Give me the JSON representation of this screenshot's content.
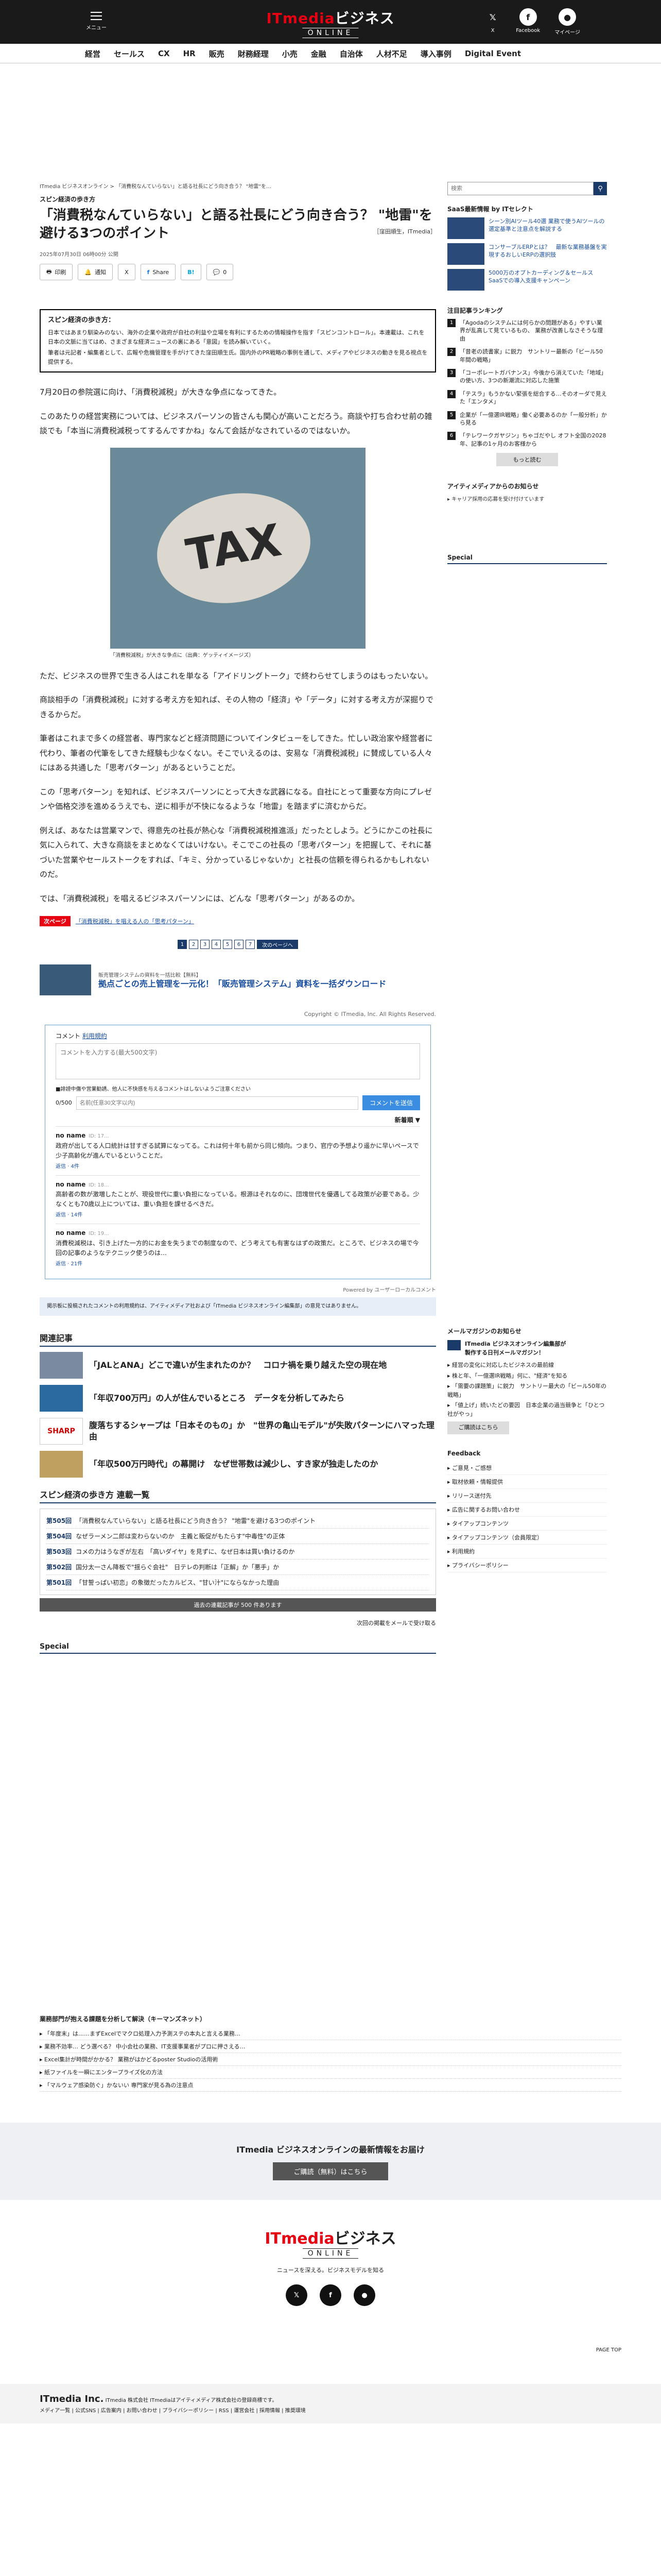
{
  "header": {
    "menu_label": "メニュー",
    "logo_main": "ITmedia",
    "logo_main2": "ビジネス",
    "logo_sub": "ONLINE",
    "x_label": "X",
    "facebook_label": "Facebook",
    "mypage_label": "マイページ"
  },
  "nav": [
    "経営",
    "セールス",
    "CX",
    "HR",
    "販売",
    "財務経理",
    "小売",
    "金融",
    "自治体",
    "人材不足",
    "導入事例",
    "Digital Event"
  ],
  "breadcrumb": "ITmedia ビジネスオンライン > 「消費税なんていらない」と語る社長にどう向き合う？ \"地雷\"を…",
  "article": {
    "series": "スピン経済の歩き方",
    "title": "「消費税なんていらない」と語る社長にどう向き合う？ \"地雷\"を避ける3つのポイント",
    "byline": "［窪田順生，ITmedia］",
    "date": "2025年07月30日 06時00分 公開",
    "share": [
      "印刷",
      "通知",
      "X",
      "Share",
      "B!",
      "0"
    ],
    "series_box_head": "スピン経済の歩き方：",
    "series_box_body": "日本ではあまり馴染みのない、海外の企業や政府が自社の利益や立場を有利にするための情報操作を指す「スピンコントロール」。本連載は、これを日本の文脈に当てはめ、さまざまな経済ニュースの裏にある「意図」を読み解いていく。",
    "series_box_body2": "筆者は元記者・編集者として、広報や危機管理を手がけてきた窪田順生氏。国内外のPR戦略の事例を通して、メディアやビジネスの動きを見る視点を提供する。",
    "p1": "7月20日の参院選に向け、「消費税減税」が大きな争点になってきた。",
    "p2": "このあたりの経営実務については、ビジネスパーソンの皆さんも関心が高いことだろう。商談や打ち合わせ前の雑談でも「本当に消費税減税ってするんですかね」なんて会話がなされているのではないか。",
    "photo_text": "TAX",
    "caption": "「消費税減税」が大きな争点に（出典：ゲッティイメージズ）",
    "p3": "ただ、ビジネスの世界で生きる人はこれを単なる「アイドリングトーク」で終わらせてしまうのはもったいない。",
    "p4": "商談相手の「消費税減税」に対する考え方を知れば、その人物の「経済」や「データ」に対する考え方が深掘りできるからだ。",
    "p5": "筆者はこれまで多くの経営者、専門家などと経済問題についてインタビューをしてきた。忙しい政治家や経営者に代わり、筆者の代筆をしてきた経験も少なくない。そこでいえるのは、安易な「消費税減税」に賛成している人々にはある共通した「思考パターン」があるということだ。",
    "p6": "この「思考パターン」を知れば、ビジネスパーソンにとって大きな武器になる。自社にとって重要な方向にプレゼンや価格交渉を進めるうえでも、逆に相手が不快になるような「地雷」を踏まずに済むからだ。",
    "p7": "例えば、あなたは営業マンで、得意先の社長が熱心な「消費税減税推進派」だったとしよう。どうにかこの社長に気に入られて、大きな商談をまとめなくてはいけない。そこでこの社長の「思考パターン」を把握して、それに基づいた営業やセールストークをすれば、「キミ、分かっているじゃないか」と社長の信頼を得られるかもしれないのだ。",
    "p8": "では、「消費税減税」を唱えるビジネスパーソンには、どんな「思考パターン」があるのか。",
    "next_tag": "次ページ",
    "next_link": "「消費税減税」を唱える人の「思考パターン」",
    "pages": [
      "1",
      "2",
      "3",
      "4",
      "5",
      "6",
      "7"
    ],
    "next_btn": "次のページへ",
    "promo_sub": "販売管理システムの資料を一括比較【無料】",
    "promo_title": "拠点ごとの売上管理を一元化！「販売管理システム」資料を一括ダウンロード",
    "copyright": "Copyright © ITmedia, Inc. All Rights Reserved."
  },
  "comments": {
    "label": "コメント",
    "label_link": "利用規約",
    "placeholder": "コメントを入力する(最大500文字)",
    "note": "■誹謗中傷や営業勧誘、他人に不快感を与えるコメントはしないようご注意ください",
    "counter": "0/500",
    "nick_placeholder": "名前(任意30文字以内)",
    "submit": "コメントを送信",
    "sort": "新着順 ▼",
    "items": [
      {
        "name": "no name",
        "date": "ID: 17...",
        "text": "政府が出してる人口統計は甘すぎる試算になってる。これは何十年も前から同じ傾向。つまり、官庁の予想より遥かに早いペースで少子高齢化が進んでいるということだ。",
        "meta": "返信 · 4件"
      },
      {
        "name": "no name",
        "date": "ID: 18...",
        "text": "高齢者の数が激増したことが、現役世代に重い負担になっている。根源はそれなのに、団塊世代を優遇してる政策が必要である。少なくとも70歳以上については、重い負担を課せるべきだ。",
        "meta": "返信 · 14件"
      },
      {
        "name": "no name",
        "date": "ID: 19...",
        "text": "消費税減税は、引き上げた一方的にお金を失うまでの制度なので、どう考えても有害なはずの政策だ。ところで、ビジネスの場で今回の記事のようなテクニック使うのは…",
        "meta": "返信 · 21件"
      }
    ],
    "powered": "Powered by ユーザーローカルコメント",
    "policy": "掲示板に投稿されたコメントの利用規約は、アイティメディア社および「ITmedia ビジネスオンライン編集部」の意見ではありません。"
  },
  "related": {
    "heading": "関連記事",
    "items": [
      {
        "title": "「JALとANA」どこで違いが生まれたのか？　コロナ禍を乗り越えた空の現在地",
        "img": ""
      },
      {
        "title": "「年収700万円」の人が住んでいるところ　データを分析してみたら",
        "img": ""
      },
      {
        "title": "腹落ちするシャープは「日本そのもの」か　\"世界の亀山モデル\"が失敗パターンにハマった理由",
        "img": "SHARP"
      },
      {
        "title": "「年収500万円時代」の幕開け　なぜ世帯数は減少し、すき家が独走したのか",
        "img": ""
      }
    ]
  },
  "series_list": {
    "heading": "スピン経済の歩き方 連載一覧",
    "items": [
      {
        "no": "第505回",
        "title": "「消費税なんていらない」と語る社長にどう向き合う？ \"地雷\"を避ける3つのポイント"
      },
      {
        "no": "第504回",
        "title": "なぜラーメン二郎は変わらないのか　主義と販促がもたらす\"中毒性\"の正体"
      },
      {
        "no": "第503回",
        "title": "コメの力はうなぎが左右　「高いダイヤ」を見ずに、なぜ日本は買い負けるのか"
      },
      {
        "no": "第502回",
        "title": "国分太一さん降板で\"揺らぐ会社\"　日テレの判断は「正解」か「悪手」か"
      },
      {
        "no": "第501回",
        "title": "「甘誓っぱい初恋」の象徴だったカルビス、\"甘い汁\"にならなかった理由"
      }
    ],
    "past": "過去の連載記事が 500 件あります",
    "mail": "次回の掲載をメールで受け取る"
  },
  "special_heading": "Special",
  "sidebar": {
    "search_placeholder": "検索",
    "saas_heading": "SaaS最新情報 by ITセレクト",
    "saas_items": [
      "シーン別AIツール40選 業務で使うAIツールの選定基準と注意点を解説する",
      "コンサーブルERPとは？　最新な業務基盤を実現するおしいERPの選択肢",
      "5000万のオプトカーディング＆セールスSaaSでの導入支援キャンペーン"
    ],
    "rank_heading": "注目記事ランキング",
    "rank": [
      "「Agodaのシステムには何らかの問題がある」やすい業界が乱高して見ているもの、 業務が改善しなさそうな理由",
      "「昔老の読書家」に鋭力　サントリー最新の「ビール50年間の戦略」",
      "「コーポレートガバナンス」今後から消えていた「地域」の使い方、3つの新潮流に対応した施策",
      "「テスラ」もうかない緊張を総合する…そのオーダで見えた「エンタメ」",
      "企業が「一億選IR戦略」働く必要あるのか「一般分析」から見る",
      "「テレワークガヤジン」ちゃゴだやし オフト全国の2028年、記事の1ヶ月のお客様から"
    ],
    "more": "もっと読む",
    "mail_heading": "アイティメディアからのお知らせ",
    "mail_text": "▸ キャリア採用の応募を受け付けています",
    "special": "Special",
    "mail2_heading": "メールマガジンのお知らせ",
    "mail2_title": "ITmedia ビジネスオンライン編集部が\n製作する日刊メールマガジン！",
    "mail2_items": [
      "▸ 経営の変化に対応したビジネスの最前線",
      "▸ 株と年、「一億選IR戦略」何に、\"経済\"を知る",
      "▸ 「需要の課題策」に鋭力　サントリー最大の「ビール50年の戦略」",
      "▸ 「値上げ」続いたどの要因　日本企業の過当競争と「ひとつ社がやっ」"
    ],
    "mail2_btn": "ご購読はこちら",
    "feedback_heading": "Feedback",
    "feedback": [
      "▸ ご意見・ご感想",
      "▸ 取材依頼・情報提供",
      "▸ リリース送付先",
      "▸ 広告に関するお問い合わせ",
      "▸ タイアップコンテンツ",
      "▸ タイアップコンテンツ（会員限定）",
      "▸ 利用規約",
      "▸ プライバシーポリシー"
    ]
  },
  "oppo": {
    "heading": "業務部門が抱える課題を分析して解決（キーマンズネット）",
    "items": [
      "▸ 「年度末」は……まずExcelでマクロ処理入力予測ステの本丸と言える業務…",
      "▸ 業務不効率… どう選べる？ 中小会社の業務、IT支援事業者がプロに押さえる…",
      "▸ Excel集計が時間がかかる？ 業務がはかどるposter Studioの活用術",
      "▸ 紙ファイルを一瞬にエンタープライズ化の方法",
      "▸ 「マルウェア感染防ぐ」かないい 専門家が見る為の注意点"
    ]
  },
  "newsband": {
    "title": "ITmedia ビジネスオンラインの最新情報をお届け",
    "btn": "ご購読（無料）はこちら"
  },
  "footer": {
    "logo_main": "ITmedia",
    "logo_main2": "ビジネス",
    "logo_sub": "ONLINE",
    "tagline": "ニュースを深える。ビジネスモデルを知る",
    "pagetop": "PAGE TOP",
    "company": "ITmedia Inc.",
    "company_text": "ITmedia 株式会社 ITmediaはアイティメディア株式会社の登録商標です。",
    "links": "メディア一覧 | 公式SNS | 広告案内 | お問い合わせ | プライバシーポリシー | RSS | 運営会社 | 採用情報 | 推奨環境"
  }
}
